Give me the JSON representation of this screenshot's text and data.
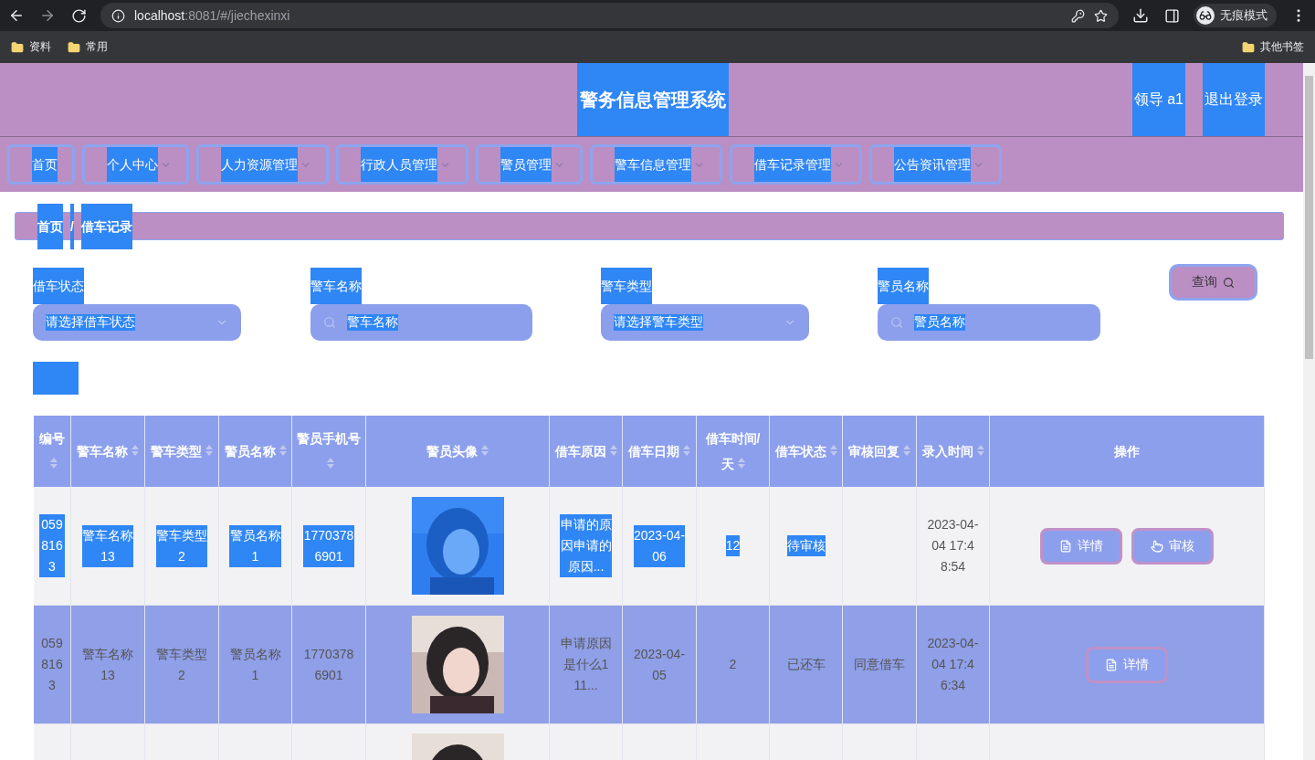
{
  "browser": {
    "url_host": "localhost",
    "url_rest": ":8081/#/jiechexinxi",
    "profile": "无痕模式",
    "bookmarks": [
      {
        "label": "资料"
      },
      {
        "label": "常用"
      }
    ],
    "other_bookmarks": "其他书签"
  },
  "header": {
    "title": "警务信息管理系统",
    "user": "领导 a1",
    "logout": "退出登录",
    "highlighted": true
  },
  "nav": [
    {
      "label": "首页",
      "dropdown": false,
      "highlighted": true
    },
    {
      "label": "个人中心",
      "dropdown": true,
      "highlighted": true
    },
    {
      "label": "人力资源管理",
      "dropdown": true,
      "highlighted": true
    },
    {
      "label": "行政人员管理",
      "dropdown": true,
      "highlighted": true
    },
    {
      "label": "警员管理",
      "dropdown": true,
      "highlighted": true
    },
    {
      "label": "警车信息管理",
      "dropdown": true,
      "highlighted": true
    },
    {
      "label": "借车记录管理",
      "dropdown": true,
      "highlighted": true
    },
    {
      "label": "公告资讯管理",
      "dropdown": true,
      "highlighted": true
    }
  ],
  "breadcrumb": {
    "items": [
      "首页",
      "借车记录"
    ],
    "separator": "/",
    "highlighted": true
  },
  "filters": [
    {
      "kind": "select",
      "label": "借车状态",
      "placeholder": "请选择借车状态",
      "highlighted": true
    },
    {
      "kind": "search",
      "label": "警车名称",
      "placeholder": "警车名称",
      "highlighted": true
    },
    {
      "kind": "select",
      "label": "警车类型",
      "placeholder": "请选择警车类型",
      "highlighted": true
    },
    {
      "kind": "search",
      "label": "警员名称",
      "placeholder": "警员名称",
      "highlighted": true
    }
  ],
  "query_button": "查询",
  "table": {
    "columns": [
      {
        "label": "编号",
        "sortable": true
      },
      {
        "label": "警车名称",
        "sortable": true
      },
      {
        "label": "警车类型",
        "sortable": true
      },
      {
        "label": "警员名称",
        "sortable": true
      },
      {
        "label": "警员手机号",
        "sortable": true
      },
      {
        "label": "警员头像",
        "sortable": true
      },
      {
        "label": "借车原因",
        "sortable": true
      },
      {
        "label": "借车日期",
        "sortable": true
      },
      {
        "label": "借车时间/天",
        "sortable": true
      },
      {
        "label": "借车状态",
        "sortable": true
      },
      {
        "label": "审核回复",
        "sortable": true
      },
      {
        "label": "录入时间",
        "sortable": true
      },
      {
        "label": "操作",
        "sortable": false
      }
    ],
    "rows": [
      {
        "hovered": false,
        "cells": [
          {
            "kind": "text",
            "text": "0598163",
            "highlighted": true
          },
          {
            "kind": "text",
            "text": "警车名称13",
            "highlighted": true
          },
          {
            "kind": "text",
            "text": "警车类型2",
            "highlighted": true
          },
          {
            "kind": "text",
            "text": "警员名称1",
            "highlighted": true
          },
          {
            "kind": "text",
            "text": "17703786901",
            "highlighted": true
          },
          {
            "kind": "picture",
            "highlighted": true
          },
          {
            "kind": "text",
            "text": "申请的原因申请的原因...",
            "highlighted": true
          },
          {
            "kind": "text",
            "text": "2023-04-06",
            "highlighted": true
          },
          {
            "kind": "text",
            "text": "12",
            "highlighted": true
          },
          {
            "kind": "text",
            "text": "待审核",
            "highlighted": true
          },
          {
            "kind": "blank"
          },
          {
            "kind": "text",
            "text": "2023-04-04 17:48:54",
            "highlighted": false
          },
          {
            "kind": "actions",
            "buttons": [
              {
                "kind": "detail",
                "label": "详情"
              },
              {
                "kind": "review",
                "label": "审核"
              }
            ]
          }
        ]
      },
      {
        "hovered": true,
        "cells": [
          {
            "kind": "text",
            "text": "0598163",
            "highlighted": false
          },
          {
            "kind": "text",
            "text": "警车名称13",
            "highlighted": false
          },
          {
            "kind": "text",
            "text": "警车类型2",
            "highlighted": false
          },
          {
            "kind": "text",
            "text": "警员名称1",
            "highlighted": false
          },
          {
            "kind": "text",
            "text": "17703786901",
            "highlighted": false
          },
          {
            "kind": "picture",
            "highlighted": false
          },
          {
            "kind": "text",
            "text": "申请原因是什么111...",
            "highlighted": false
          },
          {
            "kind": "text",
            "text": "2023-04-05",
            "highlighted": false
          },
          {
            "kind": "text",
            "text": "2",
            "highlighted": false
          },
          {
            "kind": "text",
            "text": "已还车",
            "highlighted": false
          },
          {
            "kind": "text",
            "text": "同意借车",
            "highlighted": false
          },
          {
            "kind": "text",
            "text": "2023-04-04 17:46:34",
            "highlighted": false
          },
          {
            "kind": "actions",
            "buttons": [
              {
                "kind": "detail",
                "label": "详情"
              }
            ]
          }
        ]
      },
      {
        "hovered": false,
        "cells": [
          {
            "kind": "blank"
          },
          {
            "kind": "blank"
          },
          {
            "kind": "blank"
          },
          {
            "kind": "blank"
          },
          {
            "kind": "blank"
          },
          {
            "kind": "picture",
            "highlighted": false
          },
          {
            "kind": "blank"
          },
          {
            "kind": "blank"
          },
          {
            "kind": "blank"
          },
          {
            "kind": "blank"
          },
          {
            "kind": "blank"
          },
          {
            "kind": "blank"
          },
          {
            "kind": "blank"
          }
        ]
      }
    ]
  }
}
